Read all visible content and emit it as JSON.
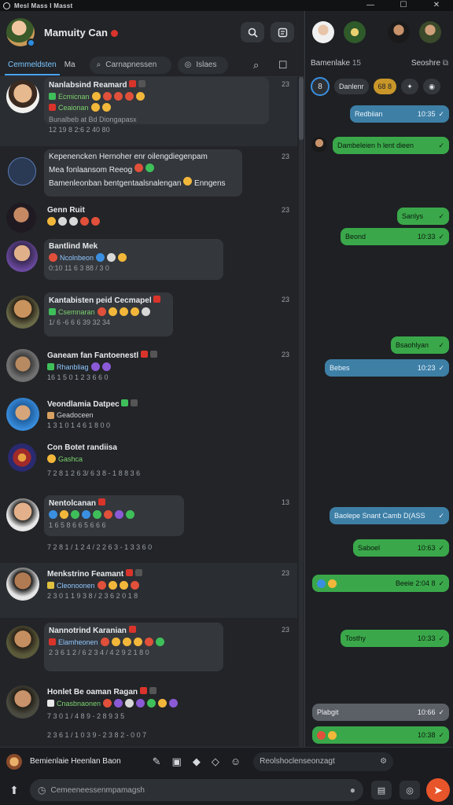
{
  "window": {
    "title": "Mesl Mass I Masst",
    "min": "—",
    "max": "☐",
    "close": "✕"
  },
  "profile": {
    "name": "Mamuity Can"
  },
  "left_tabs": {
    "active": "Cemmeldsten",
    "second": "Ma",
    "search_placeholder": "Carnapnessen",
    "filter_label": "Islaes"
  },
  "conversations": [
    {
      "name": "Nanlabsind Reamard",
      "line1": "Ecmicnan",
      "line2": "Ceaionan",
      "meta": "Bunalbeb at Bd Diongapasx",
      "meta2": "12 19 8 2:6 2 40 80",
      "time": "23"
    },
    {
      "name": "Kepenencken Hernoher enr oilengdiegenpam",
      "line1": "Mea fonlaansom Reeog",
      "line2": "Bamenleonban bentgentaalsnalengan",
      "line2b": "Enngens",
      "time": "23"
    },
    {
      "name": "Genn Ruit",
      "time": "23"
    },
    {
      "name": "Bantlind Mek",
      "line1": "Ncolnbeon",
      "meta": "0:10 11 6 3 88 / 3 0",
      "time": ""
    },
    {
      "name": "Kantabisten peid Cecmapel",
      "line1": "Csemnaran",
      "meta": "1/ 6 -6 6 6 39 32 34",
      "time": "23"
    },
    {
      "name": "Ganeam fan Fantoenestl",
      "line1": "Rhanbliag",
      "meta": "16 1 5 0 1 2 3 6 6 0",
      "time": "23"
    },
    {
      "name": "Veondlamia Datpec",
      "line1": "Geadoceen",
      "meta": "1 3 1 0 1 4 6 1 8 0 0",
      "time": ""
    },
    {
      "name": "Con Botet randiisa",
      "line1": "Gashca",
      "meta": "7 2 8 1 2 6 3/ 6 3 8 - 1 8 8 3 6",
      "time": ""
    },
    {
      "name": "Nentolcanan",
      "line1": "1 6 5 8 6 6 5 6 6 6",
      "meta": "7 2 8 1 / 1 2 4 / 2 2 6 3 - 1 3 3 6 0",
      "time": "13"
    },
    {
      "name": "Menkstrino Feamant",
      "line1": "Cleonoonen",
      "meta": "2 3 0 1 1 9 3 8 / 2 3 6 2 0 1 8",
      "time": "23"
    },
    {
      "name": "Nannotrind Karanian",
      "line1": "Elamheonen",
      "meta": "2 3 6 1 2 / 6 2 3 4 / 4 2 9 2 1 8 0",
      "time": "23"
    },
    {
      "name": "Honlet Be oaman Ragan",
      "line1": "Cnasbnaonen",
      "meta": "7 3 0 1 / 4 8 9 - 2 8 9 3 5",
      "meta2": "2 3 6 1 / 1 0 3 9 - 2 3 8 2 - 0 0 7",
      "time": ""
    }
  ],
  "right_tabs": {
    "left": "Bamenlake",
    "left_suffix": "15",
    "right": "Seoshre"
  },
  "right_chips": {
    "circle": "8",
    "chip1": "Danlenr",
    "chip2": "68 8"
  },
  "messages": [
    {
      "text": "Redbiian",
      "time": "10:35",
      "color": "b"
    },
    {
      "text": "Dambeleien h lent dieen",
      "time": "",
      "color": "g"
    },
    {
      "text": "Sanlys",
      "time": "",
      "color": "g"
    },
    {
      "text": "Beond",
      "time": "10:33",
      "color": "g"
    },
    {
      "text": "Bsaohlyan",
      "time": "",
      "color": "g"
    },
    {
      "text": "Bebes",
      "time": "10:23",
      "color": "b"
    },
    {
      "text": "Baolepe Snant Camb D(ASS",
      "time": "",
      "color": "b"
    },
    {
      "text": "Saboel",
      "time": "10:63",
      "color": "g"
    },
    {
      "text": "Beeie 2:04 8",
      "time": "",
      "color": "g"
    },
    {
      "text": "Tosthy",
      "time": "10:33",
      "color": "g"
    },
    {
      "text": "Plabgit",
      "time": "10:66",
      "color": "gr"
    },
    {
      "text": "",
      "time": "10:38",
      "color": "g"
    }
  ],
  "toolbar": {
    "label": "Bemienlaie Heenlan Baon",
    "field": "Reolshoclenseonzagt"
  },
  "composer": {
    "placeholder": "Cemeeneessenmpamagsh"
  },
  "colors": {
    "green_bubble": "#3aa84a",
    "blue_bubble": "#3e7fa6",
    "accent": "#4aa3ff",
    "send": "#e8552a"
  }
}
